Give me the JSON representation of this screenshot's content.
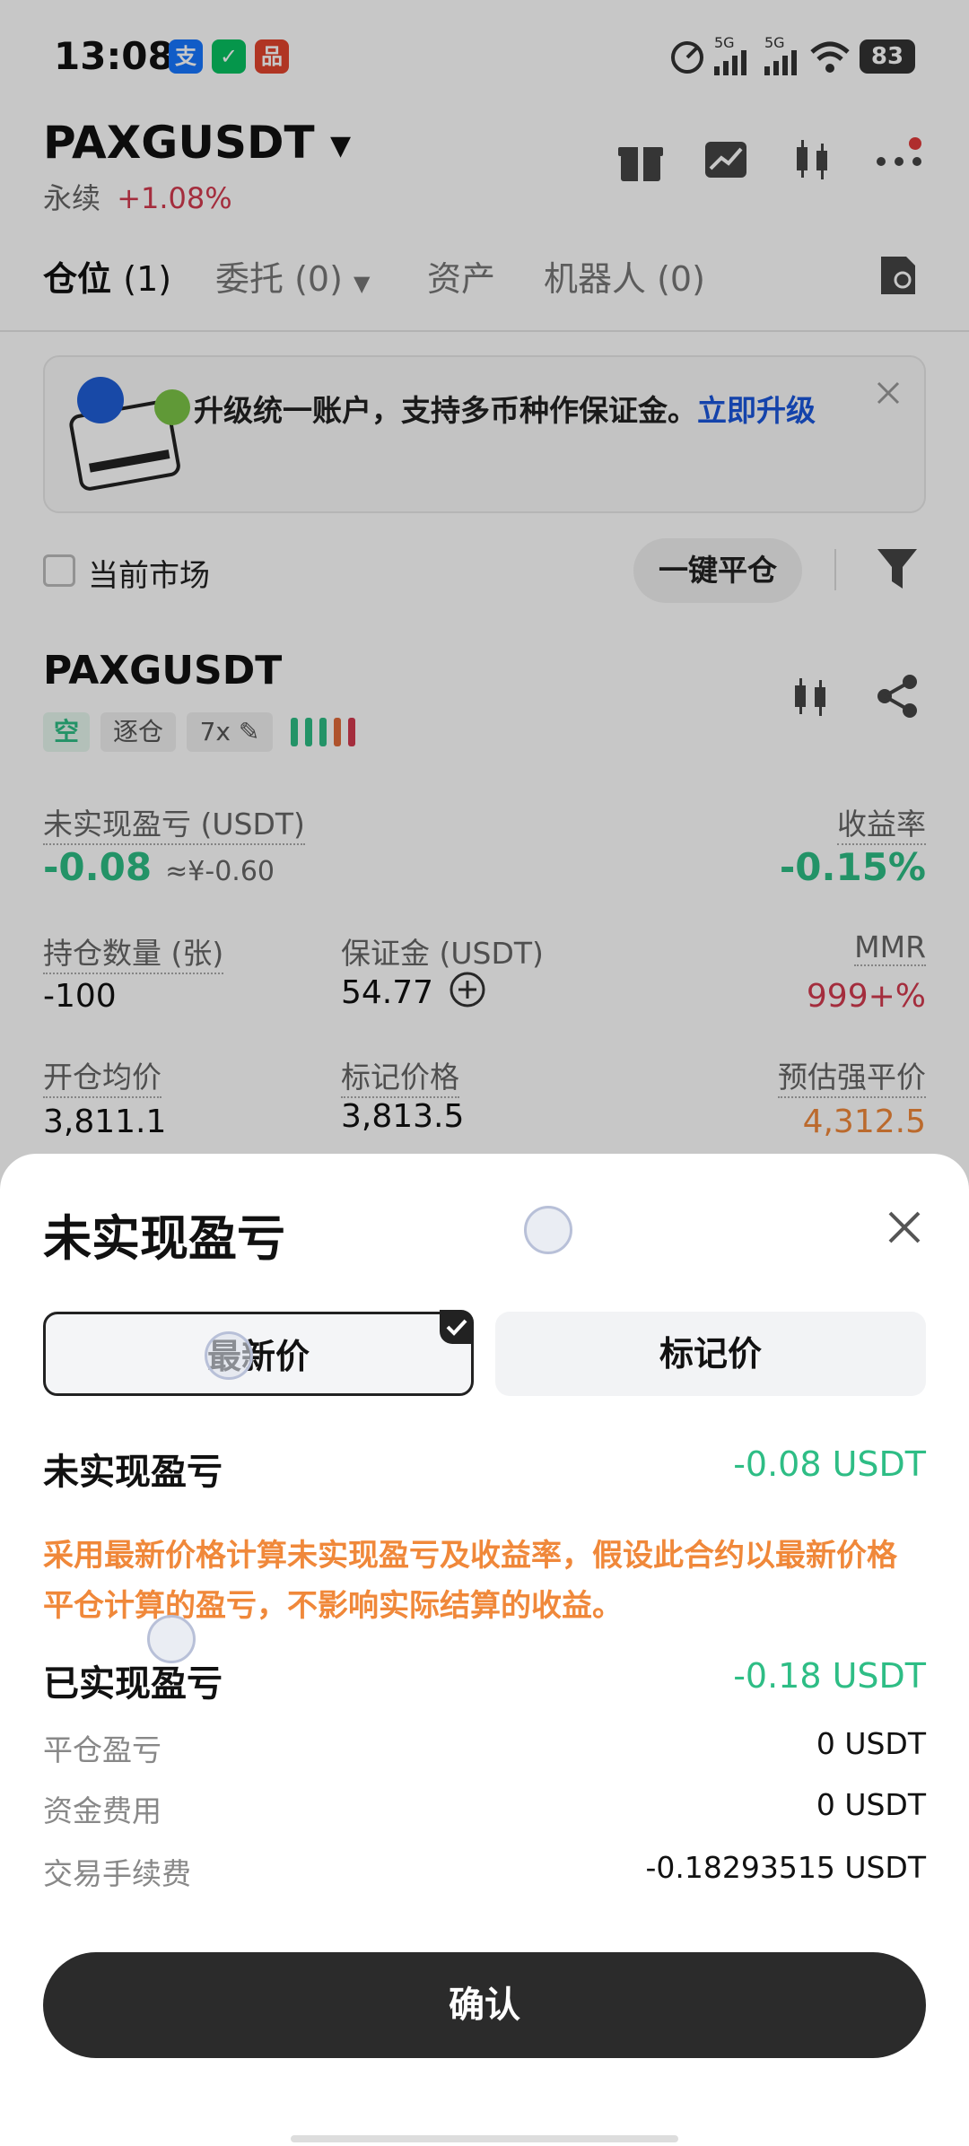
{
  "status": {
    "time": "13:08",
    "battery": "83",
    "signal_1": "5G",
    "signal_2": "5G"
  },
  "header": {
    "symbol": "PAXGUSDT",
    "sub_type": "永续",
    "change": "+1.08%"
  },
  "tabs": [
    {
      "label": "仓位",
      "count": "(1)"
    },
    {
      "label": "委托",
      "count": "(0)"
    },
    {
      "label": "资产",
      "count": ""
    },
    {
      "label": "机器人",
      "count": "(0)"
    }
  ],
  "banner": {
    "text": "升级统一账户，支持多币种作保证金。",
    "link": "立即升级"
  },
  "filter": {
    "current_market": "当前市场",
    "close_all": "一键平仓"
  },
  "position": {
    "symbol": "PAXGUSDT",
    "side": "空",
    "margin_mode": "逐仓",
    "leverage": "7x",
    "unrealized_label": "未实现盈亏",
    "unrealized_unit": "(USDT)",
    "unrealized_value": "-0.08",
    "unrealized_cny": "≈¥-0.60",
    "roe_label": "收益率",
    "roe_value": "-0.15%",
    "qty_label": "持仓数量",
    "qty_unit": "(张)",
    "qty_value": "-100",
    "margin_label": "保证金",
    "margin_unit": "(USDT)",
    "margin_value": "54.77",
    "mmr_label": "MMR",
    "mmr_value": "999+%",
    "entry_label": "开仓均价",
    "entry_value": "3,811.1",
    "mark_label": "标记价格",
    "mark_value": "3,813.5",
    "liq_label": "预估强平价",
    "liq_value": "4,312.5"
  },
  "sheet": {
    "title": "未实现盈亏",
    "seg_latest": "最新价",
    "seg_mark": "标记价",
    "unrealized_label": "未实现盈亏",
    "unrealized_value": "-0.08 USDT",
    "note": "采用最新价格计算未实现盈亏及收益率，假设此合约以最新价格平仓计算的盈亏，不影响实际结算的收益。",
    "realized_label": "已实现盈亏",
    "realized_value": "-0.18 USDT",
    "items": [
      {
        "label": "平仓盈亏",
        "value": "0 USDT"
      },
      {
        "label": "资金费用",
        "value": "0 USDT"
      },
      {
        "label": "交易手续费",
        "value": "-0.18293515 USDT"
      }
    ],
    "confirm": "确认"
  },
  "colors": {
    "green": "#2ebd85",
    "red": "#d23a4f",
    "orange": "#f0883a",
    "link_blue": "#1a56db"
  }
}
